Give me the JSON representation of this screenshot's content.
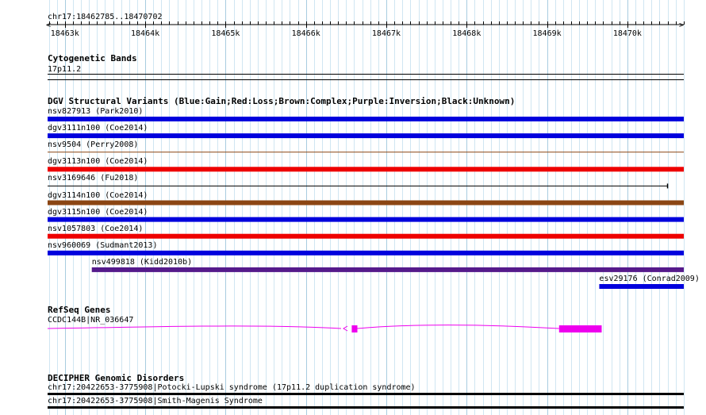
{
  "region": {
    "label": "chr17:18462785..18470702",
    "start": 18462785,
    "end": 18470702
  },
  "ruler": {
    "ticks": [
      "18463k",
      "18464k",
      "18465k",
      "18466k",
      "18467k",
      "18468k",
      "18469k",
      "18470k"
    ]
  },
  "tracks": {
    "cytoband": {
      "title": "Cytogenetic Bands",
      "band_label": "17p11.2"
    },
    "dgv": {
      "title": "DGV Structural Variants (Blue:Gain;Red:Loss;Brown:Complex;Purple:Inversion;Black:Unknown)",
      "features": [
        {
          "label": "nsv827913 (Park2010)",
          "start": 18462785,
          "end": 18470702,
          "type": "gain",
          "color": "#0000dd"
        },
        {
          "label": "dgv3111n100 (Coe2014)",
          "start": 18462785,
          "end": 18470702,
          "type": "gain",
          "color": "#0000dd"
        },
        {
          "label": "nsv9504 (Perry2008)",
          "start": 18462785,
          "end": 18470702,
          "type": "brown-thin",
          "color": "#8b4513"
        },
        {
          "label": "dgv3113n100 (Coe2014)",
          "start": 18462785,
          "end": 18470702,
          "type": "loss",
          "color": "#ee0000"
        },
        {
          "label": "nsv3169646 (Fu2018)",
          "start": 18462785,
          "end": 18470500,
          "type": "unknown",
          "color": "#000000"
        },
        {
          "label": "dgv3114n100 (Coe2014)",
          "start": 18462785,
          "end": 18470702,
          "type": "complex",
          "color": "#8b4513"
        },
        {
          "label": "dgv3115n100 (Coe2014)",
          "start": 18462785,
          "end": 18470702,
          "type": "gain",
          "color": "#0000dd"
        },
        {
          "label": "nsv1057803 (Coe2014)",
          "start": 18462785,
          "end": 18470702,
          "type": "loss",
          "color": "#ee0000"
        },
        {
          "label": "nsv960069 (Sudmant2013)",
          "start": 18462785,
          "end": 18470702,
          "type": "gain",
          "color": "#0000dd"
        },
        {
          "label": "nsv499818 (Kidd2010b)",
          "start": 18463335,
          "end": 18470702,
          "type": "inversion",
          "color": "#551a8b"
        },
        {
          "label": "esv29176 (Conrad2009)",
          "start": 18469650,
          "end": 18470702,
          "type": "gain",
          "color": "#0000dd"
        }
      ]
    },
    "refseq": {
      "title": "RefSeq Genes",
      "gene_label": "CCDC144B|NR_036647",
      "color": "#ee00ee",
      "exons": [
        {
          "start": 18466570,
          "end": 18466640
        },
        {
          "start": 18469150,
          "end": 18469680
        }
      ],
      "strand_marker": "<"
    },
    "decipher": {
      "title": "DECIPHER Genomic Disorders",
      "features": [
        {
          "label": "chr17:20422653-3775908|Potocki-Lupski syndrome (17p11.2 duplication syndrome)"
        },
        {
          "label": "chr17:20422653-3775908|Smith-Magenis Syndrome"
        }
      ]
    }
  }
}
